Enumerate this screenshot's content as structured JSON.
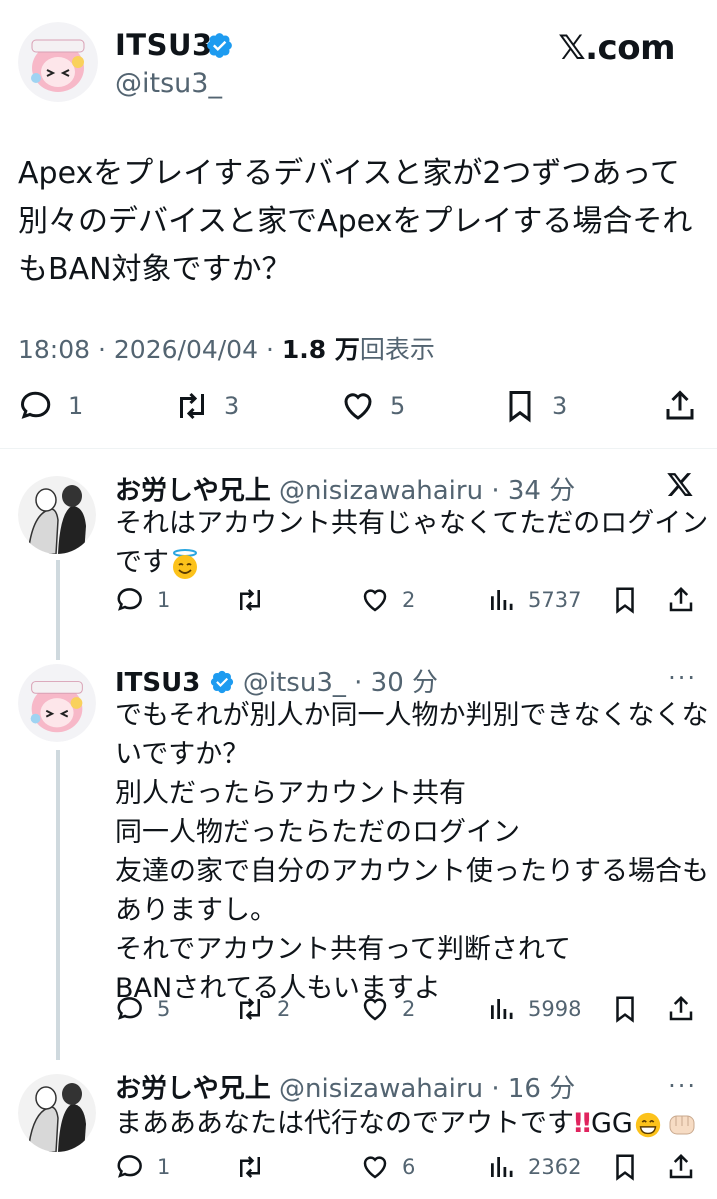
{
  "main_tweet": {
    "author_name": "ITSU3",
    "handle": "@itsu3_",
    "site": "𝕏.com",
    "text_lines": [
      "Apexをプレイするデバイスと家が2つずつあって",
      "別々のデバイスと家でApexをプレイする場合それ",
      "もBAN対象ですか？"
    ],
    "time": "18:08",
    "date": "2026/04/04",
    "views": "1.8 万",
    "views_suffix": "回表示",
    "replies": "1",
    "retweets": "3",
    "likes": "5",
    "bookmarks": "3"
  },
  "replies": [
    {
      "name": "お労しや兄上",
      "handle": "@nisizawahairu",
      "time": "34 分",
      "text_lines": [
        "それはアカウント共有じゃなくてただのログイン",
        "です"
      ],
      "emoji": "halo-smile",
      "replies": "1",
      "retweets": "",
      "likes": "2",
      "views": "5737",
      "corner": "x-logo"
    },
    {
      "name": "ITSU3",
      "handle": "@itsu3_",
      "time": "30 分",
      "text_lines": [
        "でもそれが別人か同一人物か判別できなくなくな",
        "いですか？",
        "別人だったらアカウント共有",
        "同一人物だったらただのログイン",
        "友達の家で自分のアカウント使ったりする場合も",
        "ありますし。",
        "それでアカウント共有って判断されて",
        "BANされてる人もいますよ"
      ],
      "replies": "5",
      "retweets": "2",
      "likes": "2",
      "views": "5998",
      "corner": "···"
    },
    {
      "name": "お労しや兄上",
      "handle": "@nisizawahairu",
      "time": "16 分",
      "text_lines": [
        "まあああなたは代行なのでアウトです"
      ],
      "text_suffix": "GG",
      "replies": "1",
      "retweets": "",
      "likes": "6",
      "views": "2362",
      "corner": "···"
    }
  ],
  "colors": {
    "text": "#0f1419",
    "secondary": "#536471",
    "verified": "#1d9bf0",
    "divider": "#eff3f4",
    "thread_line": "#cfd9de"
  }
}
